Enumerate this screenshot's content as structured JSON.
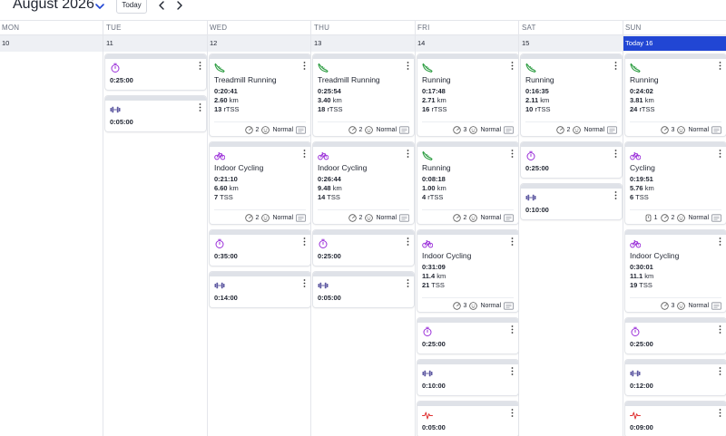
{
  "header": {
    "month_title": "August 2026",
    "today_label": "Today"
  },
  "day_headers": [
    "MON",
    "TUE",
    "WED",
    "THU",
    "FRI",
    "SAT",
    "SUN"
  ],
  "dates": [
    "10",
    "11",
    "12",
    "13",
    "14",
    "15",
    "Today 16"
  ],
  "colors": {
    "accent": "#2146d4",
    "running": "#2f9e44",
    "cycling": "#9b30d9",
    "timer": "#9b30d9",
    "strength": "#5f5aa2",
    "hr": "#e03131"
  },
  "columns": [
    [],
    [
      {
        "type": "timer",
        "icon": "stopwatch-icon",
        "solo": "0:25:00"
      },
      {
        "type": "strength",
        "icon": "dumbbell-icon",
        "solo": "0:05:00"
      }
    ],
    [
      {
        "type": "run",
        "icon": "running-shoe-icon",
        "title": "Treadmill Running",
        "time": "0:20:41",
        "dist": "2.60",
        "dist_unit": "km",
        "tss": "13",
        "tss_unit": "rTSS",
        "feel": "2",
        "mood": "Normal"
      },
      {
        "type": "bike",
        "icon": "bicycle-icon",
        "title": "Indoor Cycling",
        "time": "0:21:10",
        "dist": "6.60",
        "dist_unit": "km",
        "tss": "7",
        "tss_unit": "TSS",
        "feel": "2",
        "mood": "Normal"
      },
      {
        "type": "timer",
        "icon": "stopwatch-icon",
        "solo": "0:35:00"
      },
      {
        "type": "strength",
        "icon": "dumbbell-icon",
        "solo": "0:14:00"
      }
    ],
    [
      {
        "type": "run",
        "icon": "running-shoe-icon",
        "title": "Treadmill Running",
        "time": "0:25:54",
        "dist": "3.40",
        "dist_unit": "km",
        "tss": "18",
        "tss_unit": "rTSS",
        "feel": "2",
        "mood": "Normal"
      },
      {
        "type": "bike",
        "icon": "bicycle-icon",
        "title": "Indoor Cycling",
        "time": "0:26:44",
        "dist": "9.48",
        "dist_unit": "km",
        "tss": "14",
        "tss_unit": "TSS",
        "feel": "2",
        "mood": "Normal"
      },
      {
        "type": "timer",
        "icon": "stopwatch-icon",
        "solo": "0:25:00"
      },
      {
        "type": "strength",
        "icon": "dumbbell-icon",
        "solo": "0:05:00"
      }
    ],
    [
      {
        "type": "run",
        "icon": "running-shoe-icon",
        "title": "Running",
        "time": "0:17:48",
        "dist": "2.71",
        "dist_unit": "km",
        "tss": "16",
        "tss_unit": "rTSS",
        "feel": "3",
        "mood": "Normal"
      },
      {
        "type": "run",
        "icon": "running-shoe-icon",
        "title": "Running",
        "time": "0:08:18",
        "dist": "1.00",
        "dist_unit": "km",
        "tss": "4",
        "tss_unit": "rTSS",
        "feel": "2",
        "mood": "Normal"
      },
      {
        "type": "bike",
        "icon": "bicycle-icon",
        "title": "Indoor Cycling",
        "time": "0:31:09",
        "dist": "11.4",
        "dist_unit": "km",
        "tss": "21",
        "tss_unit": "TSS",
        "feel": "3",
        "mood": "Normal"
      },
      {
        "type": "timer",
        "icon": "stopwatch-icon",
        "solo": "0:25:00"
      },
      {
        "type": "strength",
        "icon": "dumbbell-icon",
        "solo": "0:10:00"
      },
      {
        "type": "hr",
        "icon": "heart-rate-icon",
        "solo": "0:05:00"
      }
    ],
    [
      {
        "type": "run",
        "icon": "running-shoe-icon",
        "title": "Running",
        "time": "0:16:35",
        "dist": "2.11",
        "dist_unit": "km",
        "tss": "10",
        "tss_unit": "rTSS",
        "feel": "2",
        "mood": "Normal"
      },
      {
        "type": "timer",
        "icon": "stopwatch-icon",
        "solo": "0:25:00"
      },
      {
        "type": "strength",
        "icon": "dumbbell-icon",
        "solo": "0:10:00"
      }
    ],
    [
      {
        "type": "run",
        "icon": "running-shoe-icon",
        "title": "Running",
        "time": "0:24:02",
        "dist": "3.81",
        "dist_unit": "km",
        "tss": "24",
        "tss_unit": "rTSS",
        "feel": "3",
        "mood": "Normal"
      },
      {
        "type": "bike",
        "icon": "bicycle-icon",
        "title": "Cycling",
        "time": "0:19:51",
        "dist": "5.76",
        "dist_unit": "km",
        "tss": "6",
        "tss_unit": "TSS",
        "extra": "1",
        "feel": "2",
        "mood": "Normal"
      },
      {
        "type": "bike",
        "icon": "bicycle-icon",
        "title": "Indoor Cycling",
        "time": "0:30:01",
        "dist": "11.1",
        "dist_unit": "km",
        "tss": "19",
        "tss_unit": "TSS",
        "feel": "3",
        "mood": "Normal"
      },
      {
        "type": "timer",
        "icon": "stopwatch-icon",
        "solo": "0:25:00"
      },
      {
        "type": "strength",
        "icon": "dumbbell-icon",
        "solo": "0:12:00"
      },
      {
        "type": "hr",
        "icon": "heart-rate-icon",
        "solo": "0:09:00"
      }
    ]
  ]
}
